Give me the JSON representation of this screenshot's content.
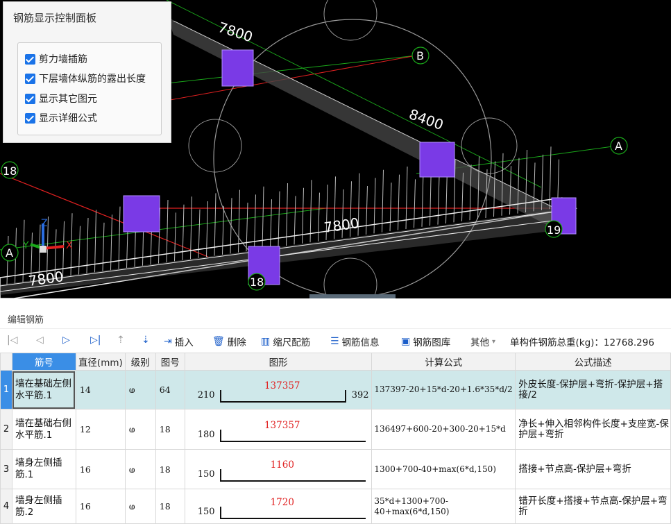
{
  "viewport": {
    "labels": [
      "7800",
      "8400",
      "7800",
      "7800"
    ],
    "axis_bubbles": [
      "B",
      "A",
      "A",
      "18",
      "18",
      "19"
    ],
    "axis_triad": {
      "x": "X",
      "y": "Y",
      "z": "Z"
    }
  },
  "panel": {
    "title": "钢筋显示控制面板",
    "options": [
      {
        "label": "剪力墙插筋",
        "checked": true
      },
      {
        "label": "下层墙体纵筋的露出长度",
        "checked": true
      },
      {
        "label": "显示其它图元",
        "checked": true
      },
      {
        "label": "显示详细公式",
        "checked": true
      }
    ]
  },
  "editor": {
    "title": "编辑钢筋",
    "toolbar": {
      "insert": "插入",
      "delete": "删除",
      "scale": "缩尺配筋",
      "info": "钢筋信息",
      "library": "钢筋图库",
      "other": "其他",
      "total_label": "单构件钢筋总重(kg)：12768.296"
    },
    "columns": [
      "筋号",
      "直径(mm)",
      "级别",
      "图号",
      "图形",
      "计算公式",
      "公式描述"
    ],
    "rows": [
      {
        "n": "1",
        "name": "墙在基础左侧水平筋.1",
        "d": "14",
        "grade": "ⱷ",
        "fig": "64",
        "left": "210",
        "mid": "137357",
        "right": "392",
        "formula": "137397-20+15*d-20+1.6*35*d/2",
        "desc": "外皮长度-保护层+弯折-保护层+搭接/2"
      },
      {
        "n": "2",
        "name": "墙在基础右侧水平筋.1",
        "d": "12",
        "grade": "ⱷ",
        "fig": "18",
        "left": "180",
        "mid": "137357",
        "right": "",
        "formula": "136497+600-20+300-20+15*d",
        "desc": "净长+伸入相邻构件长度+支座宽-保护层+弯折"
      },
      {
        "n": "3",
        "name": "墙身左侧插筋.1",
        "d": "16",
        "grade": "ⱷ",
        "fig": "18",
        "left": "150",
        "mid": "1160",
        "right": "",
        "formula": "1300+700-40+max(6*d,150)",
        "desc": "搭接+节点高-保护层+弯折"
      },
      {
        "n": "4",
        "name": "墙身左侧插筋.2",
        "d": "16",
        "grade": "ⱷ",
        "fig": "18",
        "left": "150",
        "mid": "1720",
        "right": "",
        "formula": "35*d+1300+700-40+max(6*d,150)",
        "desc": "错开长度+搭接+节点高-保护层+弯折"
      }
    ]
  }
}
